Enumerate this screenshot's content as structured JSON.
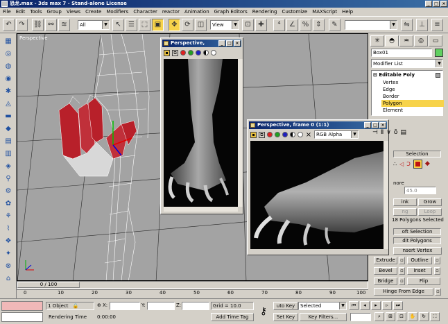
{
  "window": {
    "title": "恐龙.max - 3ds max 7 - Stand-alone License"
  },
  "menu": [
    "File",
    "Edit",
    "Tools",
    "Group",
    "Views",
    "Create",
    "Modifiers",
    "Character",
    "reactor",
    "Animation",
    "Graph Editors",
    "Rendering",
    "Customize",
    "MAXScript",
    "Help"
  ],
  "toolbar": {
    "selection_filter": "All",
    "reference_coord": "View"
  },
  "viewport": {
    "label": "Perspective"
  },
  "render_small": {
    "title": "Perspective,"
  },
  "render_large": {
    "title": "Perspective, frame 0 (1:1)",
    "channel": "RGB Alpha"
  },
  "panel": {
    "object_name": "Box01",
    "modifier_list": "Modifier List",
    "stack": {
      "root": "Editable Poly",
      "items": [
        "Vertex",
        "Edge",
        "Border",
        "Polygon",
        "Element"
      ],
      "selected": "Polygon"
    },
    "selection_rollout": "Selection",
    "ignore_label": "nore",
    "angle_value": "45.0",
    "shrink": "ink",
    "grow": "Grow",
    "ring": "ng",
    "loop": "Loop",
    "selected_count": "18 Polygons Selected",
    "soft_selection": "oft Selection",
    "edit_polygons": "dit Polygons",
    "insert_vertex": "nsert Vertex",
    "extrude": "Extrude",
    "outline": "Outline",
    "bevel": "Bevel",
    "inset": "Inset",
    "bridge": "Bridge",
    "flip": "Flip",
    "hinge": "Hinge From Edge"
  },
  "timeline": {
    "frame_counter": "0 / 100",
    "ticks": [
      "0",
      "10",
      "20",
      "30",
      "40",
      "50",
      "60",
      "70",
      "80",
      "90",
      "100"
    ]
  },
  "status": {
    "objects": "1 Object",
    "x_label": "X:",
    "y_label": "Y:",
    "z_label": "Z:",
    "grid": "Grid = 10.0",
    "auto_key": "uto Key",
    "set_key": "Set Key",
    "selected_filter": "Selected",
    "key_filters": "Key Filters...",
    "rendering_time_label": "Rendering Time",
    "rendering_time": "0:00:00",
    "add_time_tag": "Add Time Tag"
  }
}
